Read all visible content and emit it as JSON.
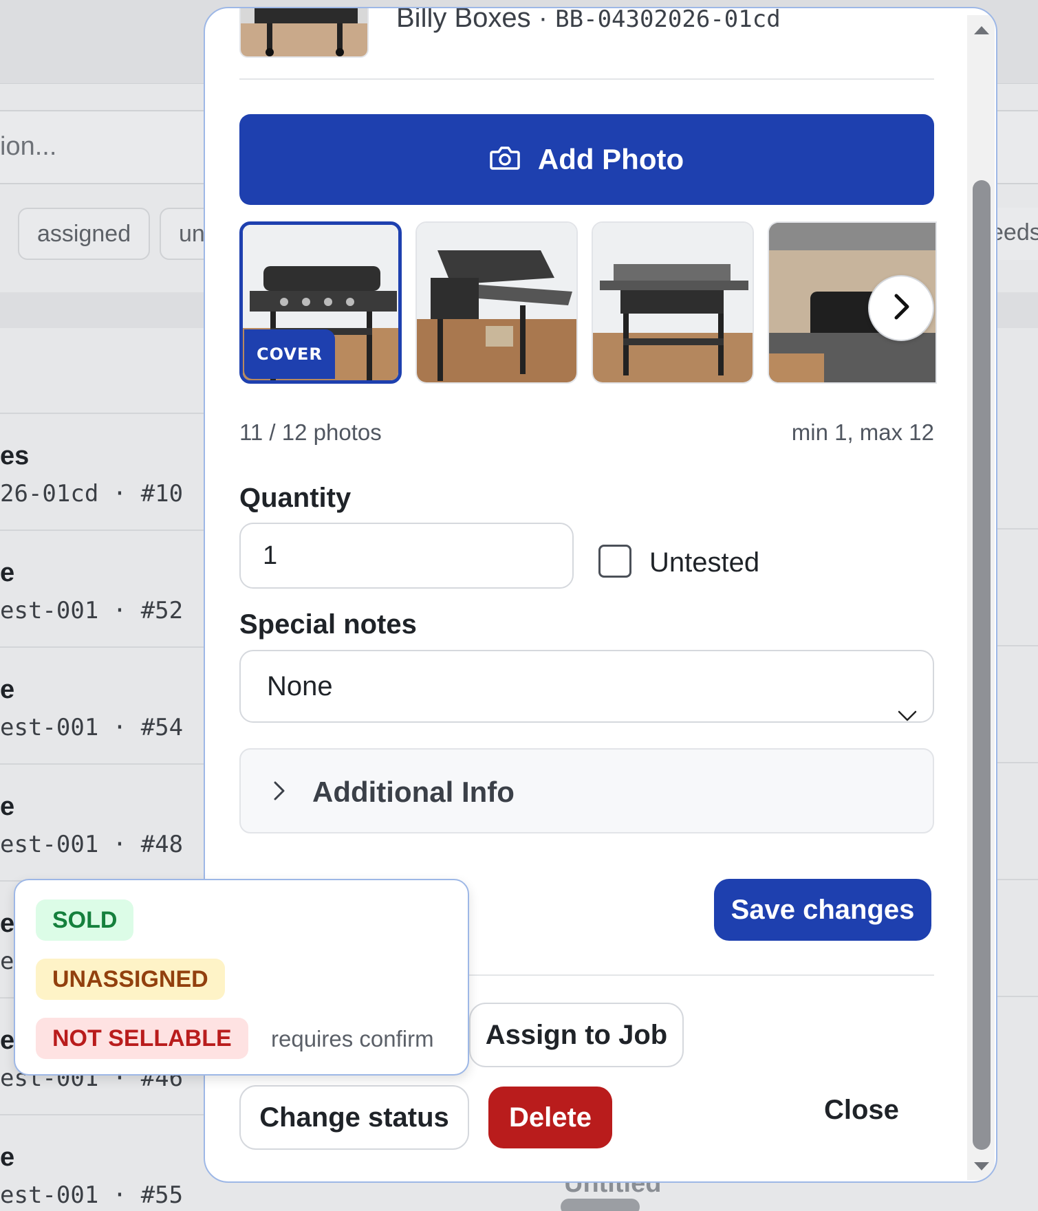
{
  "background": {
    "search_placeholder_fragment": "ion...",
    "chips": [
      "assigned",
      "un",
      "eeds"
    ],
    "rows": [
      {
        "title": "es",
        "sub": "26-01cd · #10"
      },
      {
        "title": "e",
        "sub": "est-001 · #52"
      },
      {
        "title": "e",
        "sub": "est-001 · #54"
      },
      {
        "title": "e",
        "sub": "est-001 · #48"
      },
      {
        "title": "e",
        "sub": "e"
      },
      {
        "title": "e",
        "sub": "est-001 · #46"
      },
      {
        "title": "e",
        "sub": "est-001 · #55"
      }
    ],
    "bottom_text": "Untitled"
  },
  "modal": {
    "header": {
      "title": "Billy Boxes · ",
      "code": "BB-04302026-01cd"
    },
    "add_photo_label": "Add Photo",
    "cover_badge": "COVER",
    "photo_count": "11 / 12 photos",
    "photo_limits": "min 1, max 12",
    "quantity_label": "Quantity",
    "quantity_value": "1",
    "untested_label": "Untested",
    "untested_checked": false,
    "special_notes_label": "Special notes",
    "special_notes_value": "None",
    "additional_info_label": "Additional Info",
    "save_label": "Save changes",
    "assign_label": "Assign to Job",
    "change_status_label": "Change status",
    "delete_label": "Delete",
    "close_label": "Close"
  },
  "status_menu": {
    "options": [
      {
        "label": "SOLD",
        "color": "#15803d"
      },
      {
        "label": "UNASSIGNED",
        "color": "#92400e"
      },
      {
        "label": "NOT SELLABLE",
        "color": "#b91c1c"
      }
    ],
    "confirm_note": "requires confirm"
  },
  "colors": {
    "primary": "#1e40af",
    "danger": "#b91c1c"
  }
}
